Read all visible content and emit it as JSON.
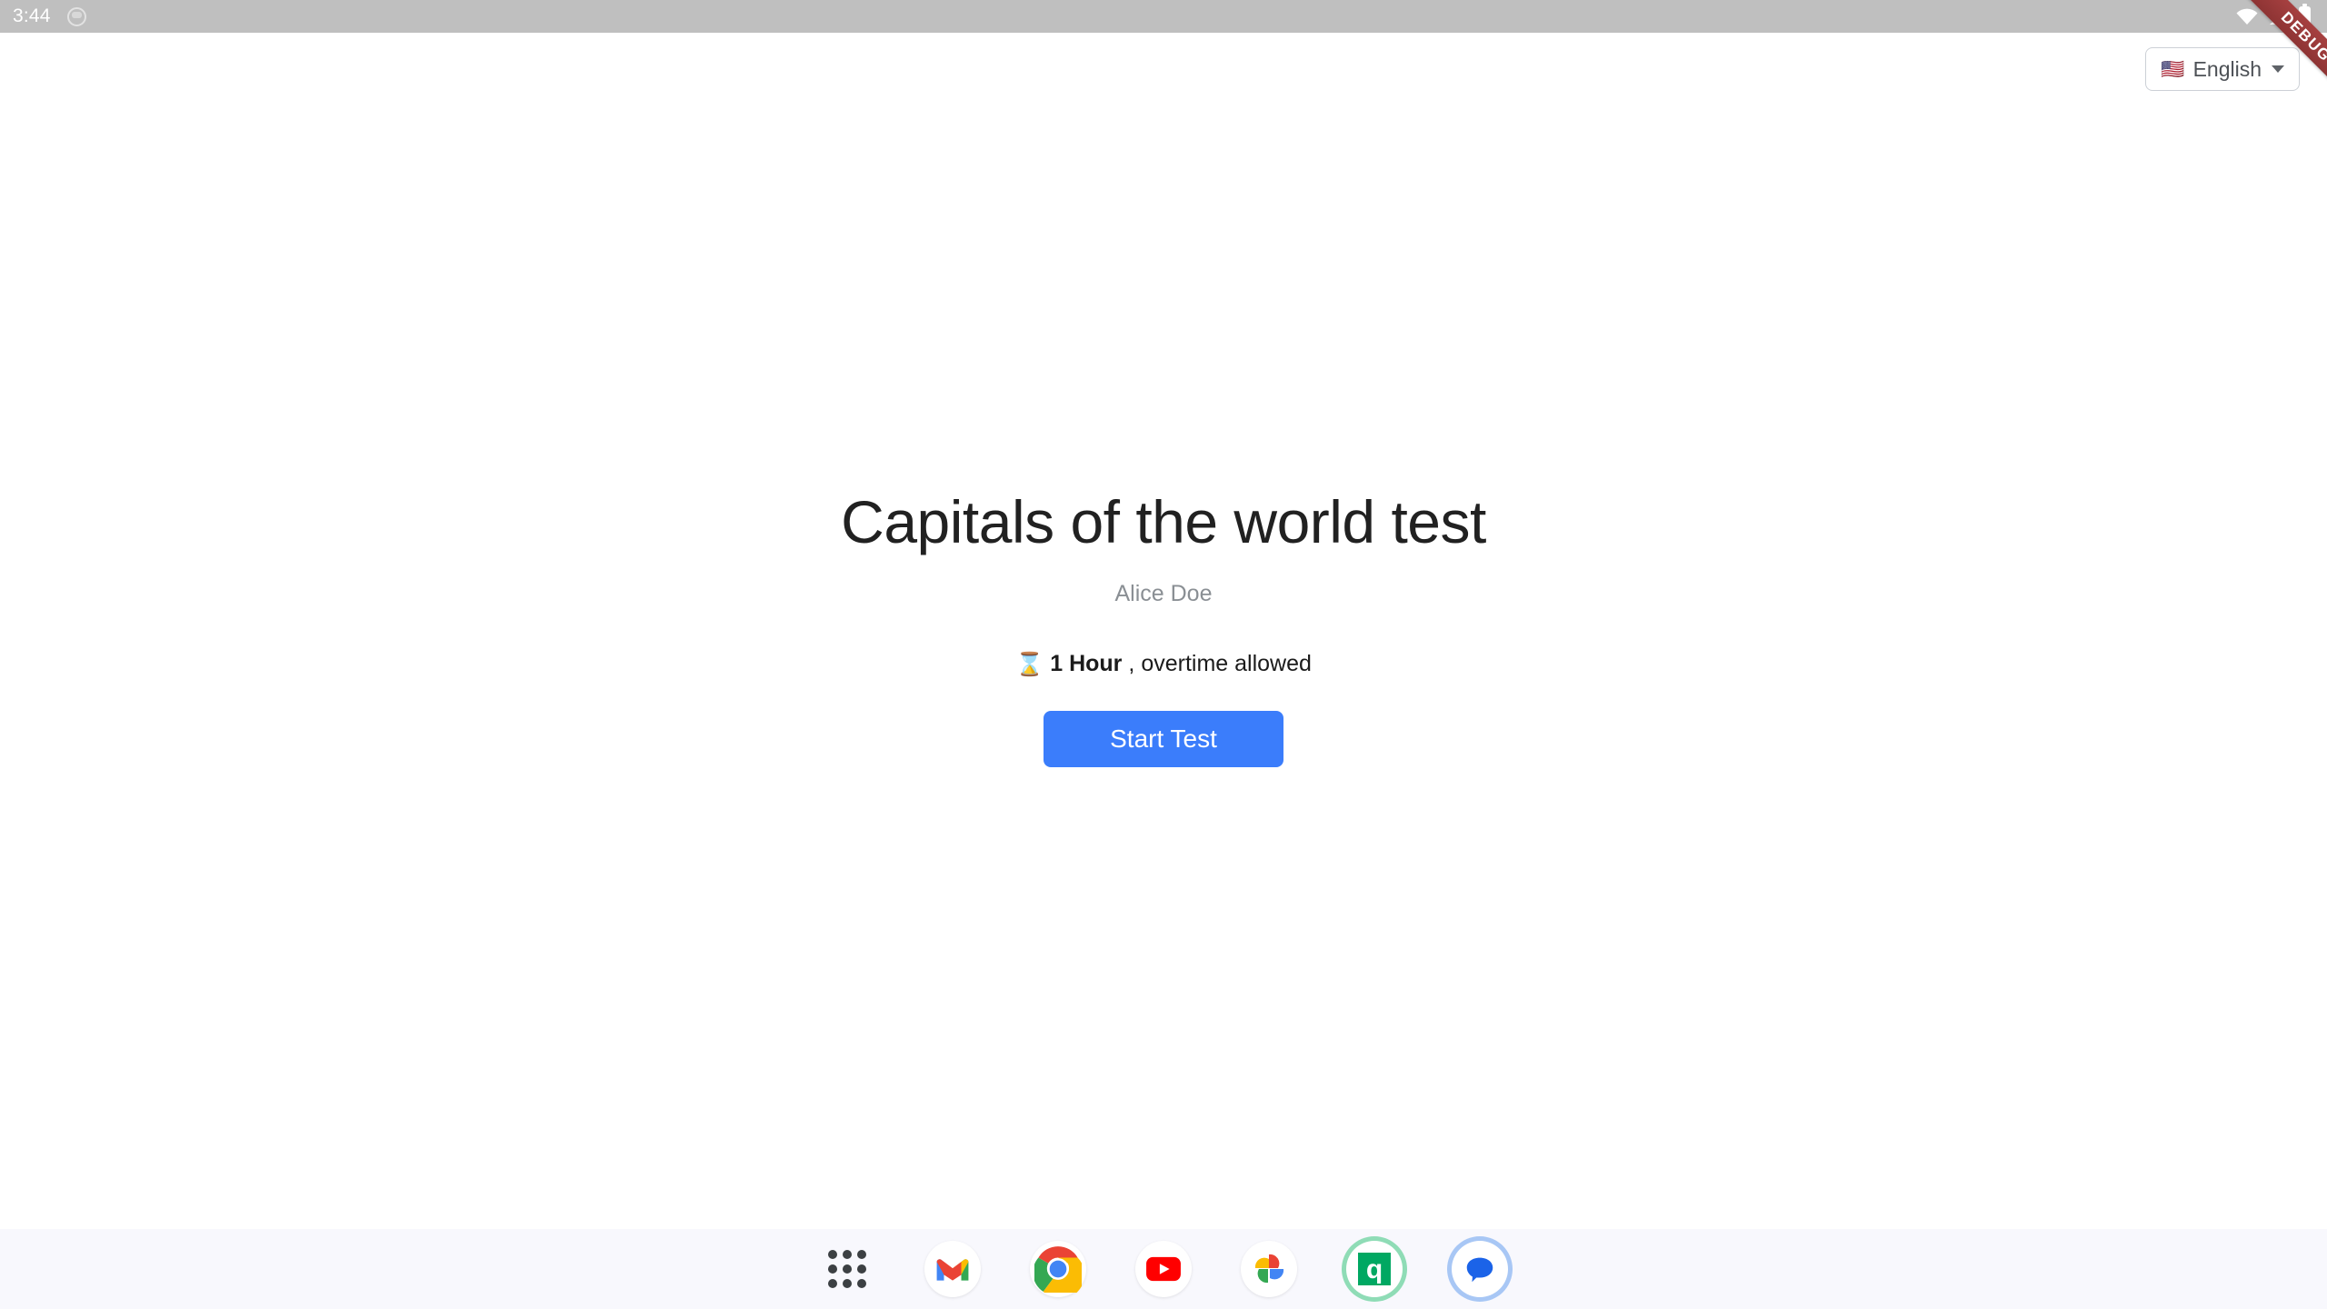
{
  "status_bar": {
    "clock": "3:44",
    "notification_icon": "notification-circle-icon",
    "wifi_icon": "wifi-icon",
    "signal_icon": "cell-signal-icon",
    "battery_icon": "battery-icon",
    "background_color": "#bfbfbf"
  },
  "debug_ribbon": {
    "label": "DEBUG",
    "color": "#9b3a3a"
  },
  "language_selector": {
    "flag": "🇺🇸",
    "label": "English",
    "caret_icon": "chevron-down-icon"
  },
  "test": {
    "title": "Capitals of the world test",
    "author": "Alice Doe",
    "duration_icon": "⌛",
    "duration_value": "1 Hour",
    "duration_note": ", overtime allowed",
    "start_button_label": "Start Test",
    "start_button_color": "#3b7dfb"
  },
  "dock": {
    "background_color": "#f8f8fd",
    "items": [
      {
        "name": "all-apps",
        "label": "All apps"
      },
      {
        "name": "gmail",
        "label": "Gmail"
      },
      {
        "name": "chrome",
        "label": "Chrome"
      },
      {
        "name": "youtube",
        "label": "YouTube"
      },
      {
        "name": "google-photos",
        "label": "Photos"
      },
      {
        "name": "quizalize",
        "label": "q"
      },
      {
        "name": "messages",
        "label": "Messages"
      }
    ]
  }
}
